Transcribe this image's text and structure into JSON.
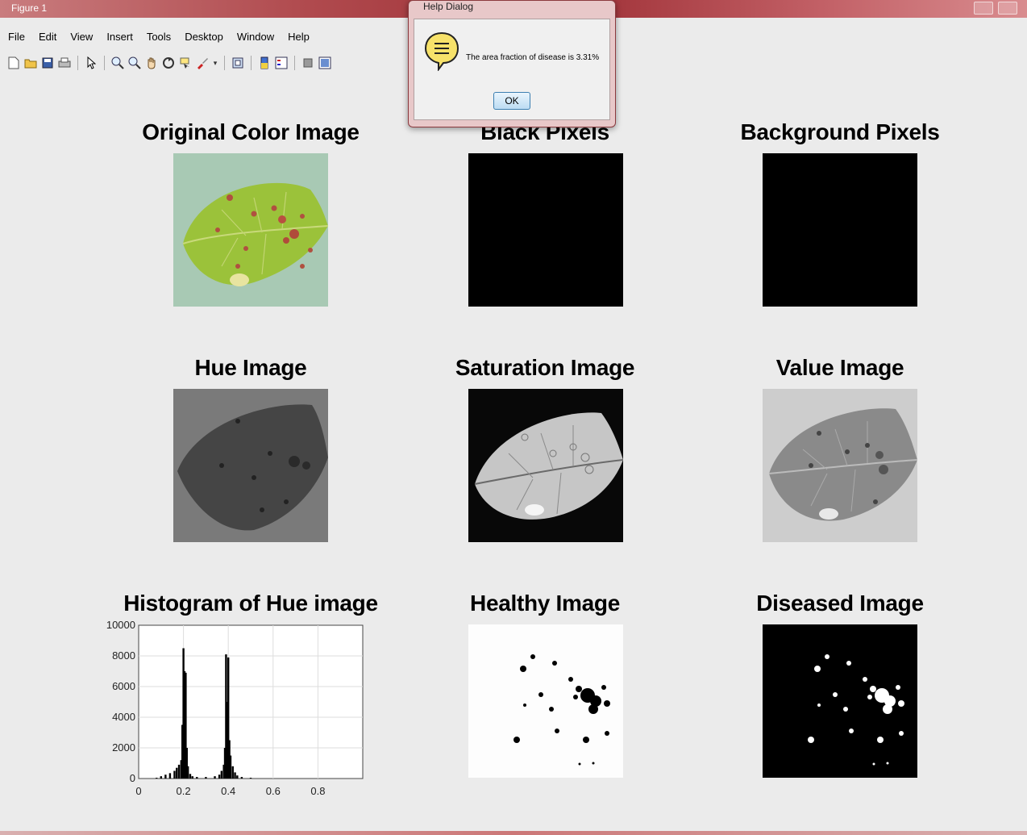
{
  "window": {
    "title": "Figure 1"
  },
  "menu": [
    "File",
    "Edit",
    "View",
    "Insert",
    "Tools",
    "Desktop",
    "Window",
    "Help"
  ],
  "toolbar_icons": [
    "new-figure-icon",
    "open-file-icon",
    "save-icon",
    "print-icon",
    "pointer-icon",
    "zoom-in-icon",
    "zoom-out-icon",
    "pan-icon",
    "rotate-icon",
    "data-cursor-icon",
    "brush-icon",
    "link-icon",
    "colorbar-icon",
    "legend-icon",
    "hide-plot-tools-icon",
    "show-plot-tools-icon"
  ],
  "dialog": {
    "title": "Help Dialog",
    "message": "The area fraction of disease is 3.31%",
    "ok_label": "OK"
  },
  "panels": {
    "original": "Original Color Image",
    "black": "Black Pixels",
    "background": "Background Pixels",
    "hue": "Hue Image",
    "saturation": "Saturation Image",
    "value": "Value Image",
    "histogram": "Histogram of Hue image",
    "healthy": "Healthy Image",
    "diseased": "Diseased Image"
  },
  "colors": {
    "titlebar": "#a8383e",
    "figure_bg": "#ebebeb",
    "leaf_green": "#9ac23a",
    "leaf_bg": "#a7c8b3"
  },
  "chart_data": {
    "type": "bar",
    "title": "Histogram of Hue image",
    "xlim": [
      0,
      1
    ],
    "ylim": [
      0,
      10000
    ],
    "xticks": [
      0,
      0.2,
      0.4,
      0.6,
      0.8
    ],
    "yticks": [
      0,
      2000,
      4000,
      6000,
      8000,
      10000
    ],
    "grid": true,
    "x": [
      0.08,
      0.1,
      0.12,
      0.14,
      0.16,
      0.17,
      0.18,
      0.19,
      0.195,
      0.2,
      0.205,
      0.21,
      0.215,
      0.22,
      0.23,
      0.24,
      0.26,
      0.3,
      0.34,
      0.36,
      0.37,
      0.38,
      0.385,
      0.39,
      0.395,
      0.4,
      0.405,
      0.41,
      0.42,
      0.43,
      0.44,
      0.46,
      0.5
    ],
    "values": [
      50,
      150,
      250,
      350,
      500,
      700,
      900,
      1200,
      3500,
      8500,
      7000,
      6900,
      2000,
      800,
      300,
      150,
      100,
      100,
      150,
      250,
      500,
      900,
      2000,
      8100,
      5000,
      7900,
      2500,
      1500,
      800,
      400,
      200,
      100,
      50
    ]
  }
}
